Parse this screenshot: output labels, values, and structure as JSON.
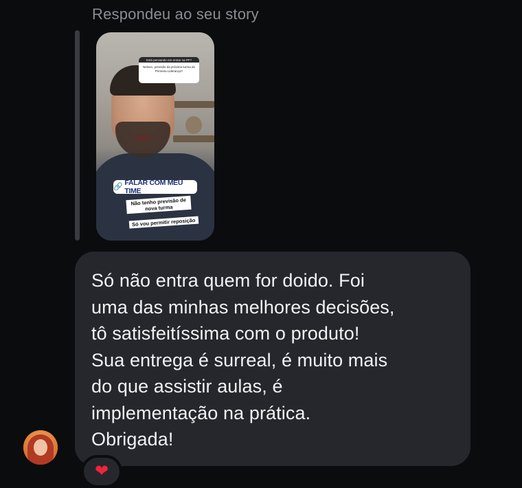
{
  "reply_header": "Respondeu ao seu story",
  "story": {
    "question_top": "Está pensando em entrar na PF?",
    "question_body": "Nelson, previsão da próxima turma do Primeira Liderança?",
    "link_sticker_label": "FALAR COM MEU TIME",
    "caption_1": "Não tenho previsão de nova turma",
    "caption_2": "Só vou permitir reposição"
  },
  "message": {
    "text": "Só não entra quem for doido. Foi\numa das minhas melhores decisões,\ntô satisfeitíssima com o produto!\nSua entrega é surreal, é muito mais\ndo que assistir aulas, é\nimplementação na prática.\nObrigada!"
  },
  "reaction": {
    "emoji": "❤"
  },
  "icons": {
    "link": "link-icon",
    "heart": "heart-icon"
  },
  "colors": {
    "background": "#0b0c0e",
    "bubble": "#26272d",
    "link_text": "#1c2e78",
    "link_icon": "#d6257c",
    "heart": "#f0243c"
  }
}
